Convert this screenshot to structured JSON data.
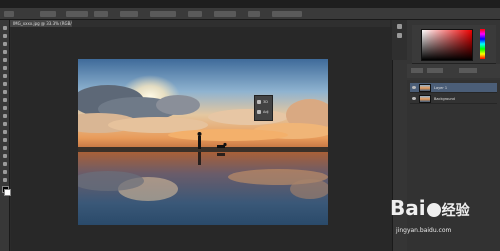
{
  "document": {
    "tab_label": "IMG_xxxx.jpg @ 33.3% (RGB/8#)"
  },
  "photo": {
    "subject": "silhouette of a person walking a dog at sunset by the water"
  },
  "float_panel": {
    "items": [
      "3D",
      "Adj"
    ]
  },
  "layers": {
    "rows": [
      {
        "name": "Layer 1",
        "selected": true
      },
      {
        "name": "Background",
        "selected": false
      }
    ]
  },
  "watermark": {
    "logo": "Bai",
    "logo_tail": "经验",
    "url": "jingyan.baidu.com"
  },
  "colors": {
    "accent": "#4b5e78",
    "ui_bg": "#2b2b2b"
  }
}
